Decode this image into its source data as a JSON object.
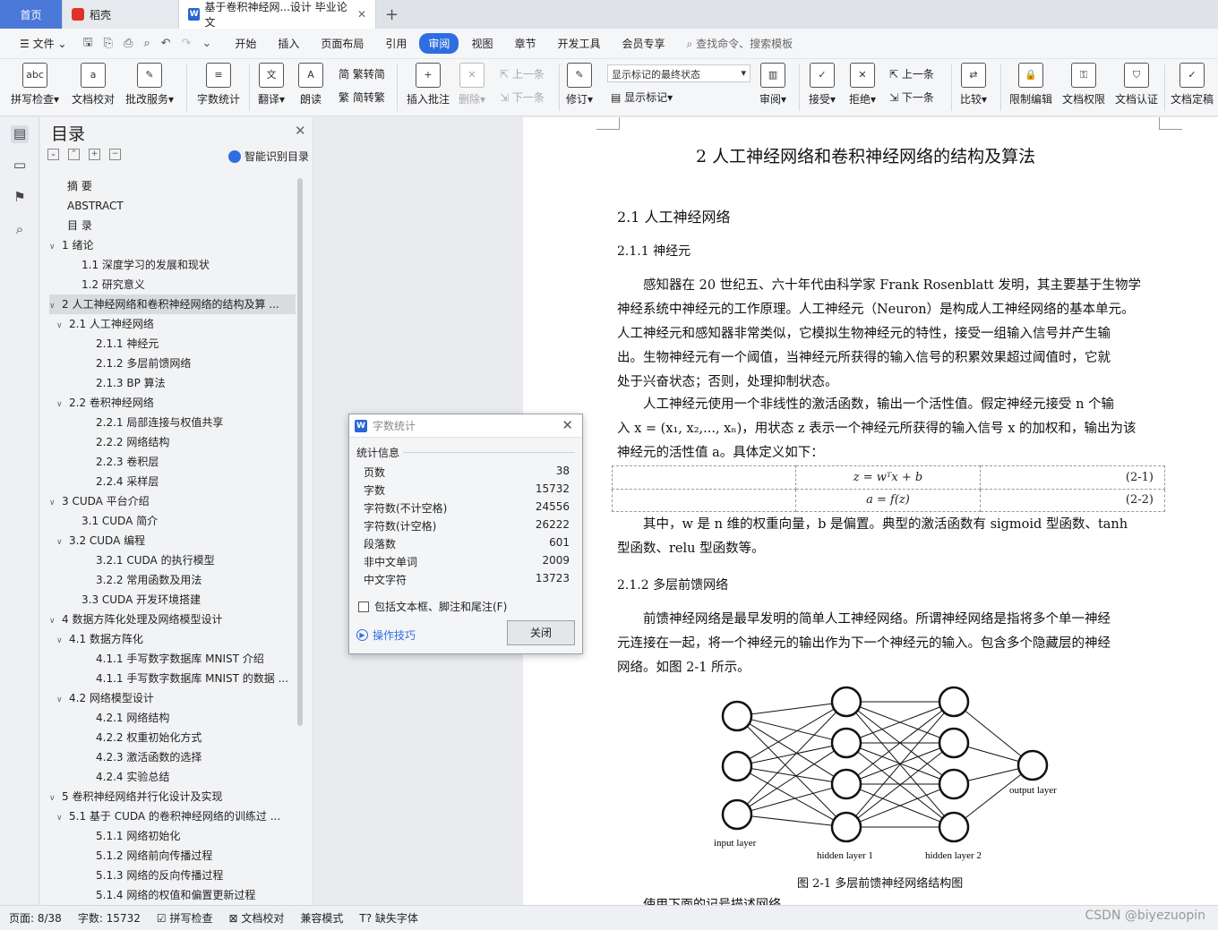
{
  "tabs": {
    "home": "首页",
    "daoke": "稻壳",
    "doc": "基于卷积神经网...设计 毕业论文"
  },
  "menu": {
    "file": "文件",
    "items": [
      "开始",
      "插入",
      "页面布局",
      "引用",
      "审阅",
      "视图",
      "章节",
      "开发工具",
      "会员专享"
    ],
    "active": "审阅",
    "search": "查找命令、搜索模板"
  },
  "ribbon": {
    "spell": "拼写检查",
    "proof": "文档校对",
    "annotate": "批改服务",
    "wordcount": "字数统计",
    "translate": "翻译",
    "read": "朗读",
    "trad": "繁转简",
    "simp": "简转繁",
    "insert_comment": "插入批注",
    "delete": "删除",
    "prev": "上一条",
    "next": "下一条",
    "revise": "修订",
    "display_select": "显示标记的最终状态",
    "show_marks": "显示标记",
    "review": "审阅",
    "accept": "接受",
    "reject": "拒绝",
    "prev2": "上一条",
    "next2": "下一条",
    "compare": "比较",
    "restrict": "限制编辑",
    "rights": "文档权限",
    "cert": "文档认证",
    "final": "文档定稿"
  },
  "nav": {
    "title": "目录",
    "smart": "智能识别目录",
    "items": [
      {
        "t": "摘  要",
        "lv": 1,
        "arrow": ""
      },
      {
        "t": "ABSTRACT",
        "lv": 1,
        "arrow": ""
      },
      {
        "t": "目  录",
        "lv": 1,
        "arrow": ""
      },
      {
        "t": "1  绪论",
        "lv": 1,
        "arrow": "﹀"
      },
      {
        "t": "1.1  深度学习的发展和现状",
        "lv": 2,
        "arrow": ""
      },
      {
        "t": "1.2  研究意义",
        "lv": 2,
        "arrow": ""
      },
      {
        "t": "2  人工神经网络和卷积神经网络的结构及算 ...",
        "lv": 1,
        "arrow": "﹀",
        "sel": true
      },
      {
        "t": "2.1  人工神经网络",
        "lv": 2,
        "arrow": "﹀"
      },
      {
        "t": "2.1.1  神经元",
        "lv": 3,
        "arrow": ""
      },
      {
        "t": "2.1.2  多层前馈网络",
        "lv": 3,
        "arrow": ""
      },
      {
        "t": "2.1.3 BP 算法",
        "lv": 3,
        "arrow": ""
      },
      {
        "t": "2.2  卷积神经网络",
        "lv": 2,
        "arrow": "﹀"
      },
      {
        "t": "2.2.1  局部连接与权值共享",
        "lv": 3,
        "arrow": ""
      },
      {
        "t": "2.2.2  网络结构",
        "lv": 3,
        "arrow": ""
      },
      {
        "t": "2.2.3  卷积层",
        "lv": 3,
        "arrow": ""
      },
      {
        "t": "2.2.4  采样层",
        "lv": 3,
        "arrow": ""
      },
      {
        "t": "3 CUDA 平台介绍",
        "lv": 1,
        "arrow": "﹀"
      },
      {
        "t": "3.1 CUDA 简介",
        "lv": 2,
        "arrow": ""
      },
      {
        "t": "3.2 CUDA 编程",
        "lv": 2,
        "arrow": "﹀"
      },
      {
        "t": "3.2.1 CUDA 的执行模型",
        "lv": 3,
        "arrow": ""
      },
      {
        "t": "3.2.2  常用函数及用法",
        "lv": 3,
        "arrow": ""
      },
      {
        "t": "3.3 CUDA 开发环境搭建",
        "lv": 2,
        "arrow": ""
      },
      {
        "t": "4  数据方阵化处理及网络模型设计",
        "lv": 1,
        "arrow": "﹀"
      },
      {
        "t": "4.1  数据方阵化",
        "lv": 2,
        "arrow": "﹀"
      },
      {
        "t": "4.1.1  手写数字数据库 MNIST 介绍",
        "lv": 3,
        "arrow": ""
      },
      {
        "t": "4.1.1  手写数字数据库 MNIST 的数据 ...",
        "lv": 3,
        "arrow": ""
      },
      {
        "t": "4.2  网络模型设计",
        "lv": 2,
        "arrow": "﹀"
      },
      {
        "t": "4.2.1  网络结构",
        "lv": 3,
        "arrow": ""
      },
      {
        "t": "4.2.2  权重初始化方式",
        "lv": 3,
        "arrow": ""
      },
      {
        "t": "4.2.3  激活函数的选择",
        "lv": 3,
        "arrow": ""
      },
      {
        "t": "4.2.4  实验总结",
        "lv": 3,
        "arrow": ""
      },
      {
        "t": "5  卷积神经网络并行化设计及实现",
        "lv": 1,
        "arrow": "﹀"
      },
      {
        "t": "5.1  基于 CUDA 的卷积神经网络的训练过 ...",
        "lv": 2,
        "arrow": "﹀"
      },
      {
        "t": "5.1.1  网络初始化",
        "lv": 3,
        "arrow": ""
      },
      {
        "t": "5.1.2  网络前向传播过程",
        "lv": 3,
        "arrow": ""
      },
      {
        "t": "5.1.3  网络的反向传播过程",
        "lv": 3,
        "arrow": ""
      },
      {
        "t": "5.1.4  网络的权值和偏置更新过程",
        "lv": 3,
        "arrow": ""
      }
    ]
  },
  "doc": {
    "h1": "2  人工神经网络和卷积神经网络的结构及算法",
    "h2": "2.1  人工神经网络",
    "h3a": "2.1.1  神经元",
    "p1": [
      "感知器在 20 世纪五、六十年代由科学家 Frank Rosenblatt 发明，其主要基于生物学",
      "神经系统中神经元的工作原理。人工神经元（Neuron）是构成人工神经网络的基本单元。",
      "人工神经元和感知器非常类似，它模拟生物神经元的特性，接受一组输入信号并产生输",
      "出。生物神经元有一个阈值，当神经元所获得的输入信号的积累效果超过阈值时，它就",
      "处于兴奋状态；否则，处理抑制状态。"
    ],
    "p2": [
      "人工神经元使用一个非线性的激活函数，输出一个活性值。假定神经元接受 n 个输",
      "入 x = (x₁, x₂,..., xₙ)，用状态 z 表示一个神经元所获得的输入信号 x 的加权和，输出为该",
      "神经元的活性值 a。具体定义如下："
    ],
    "eq1": "z = wᵀx + b",
    "eq1n": "(2-1)",
    "eq2": "a = f(z)",
    "eq2n": "(2-2)",
    "p3": [
      "其中，w 是 n 维的权重向量，b 是偏置。典型的激活函数有 sigmoid 型函数、tanh",
      "型函数、relu 型函数等。"
    ],
    "h3b": "2.1.2  多层前馈网络",
    "p4": [
      "前馈神经网络是最早发明的简单人工神经网络。所谓神经网络是指将多个单一神经",
      "元连接在一起，将一个神经元的输出作为下一个神经元的输入。包含多个隐藏层的神经",
      "网络。如图 2-1 所示。"
    ],
    "fig_labels": {
      "input": "input layer",
      "h1": "hidden layer 1",
      "h2": "hidden layer 2",
      "output": "output layer"
    },
    "caption": "图  2-1  多层前馈神经网络结构图",
    "cut": "使用下面的记号描述网络"
  },
  "dialog": {
    "title": "字数统计",
    "section": "统计信息",
    "stats": [
      [
        "页数",
        "38"
      ],
      [
        "字数",
        "15732"
      ],
      [
        "字符数(不计空格)",
        "24556"
      ],
      [
        "字符数(计空格)",
        "26222"
      ],
      [
        "段落数",
        "601"
      ],
      [
        "非中文单词",
        "2009"
      ],
      [
        "中文字符",
        "13723"
      ]
    ],
    "checkbox": "包括文本框、脚注和尾注(F)",
    "tips": "操作技巧",
    "close": "关闭"
  },
  "status": {
    "page": "页面: 8/38",
    "words": "字数: 15732",
    "spell": "拼写检查",
    "proof": "文档校对",
    "compat": "兼容模式",
    "font": "缺失字体",
    "watermark": "CSDN @biyezuopin"
  },
  "colors": {
    "accent": "#2f6ee0",
    "home_tab": "#4a79d9"
  }
}
